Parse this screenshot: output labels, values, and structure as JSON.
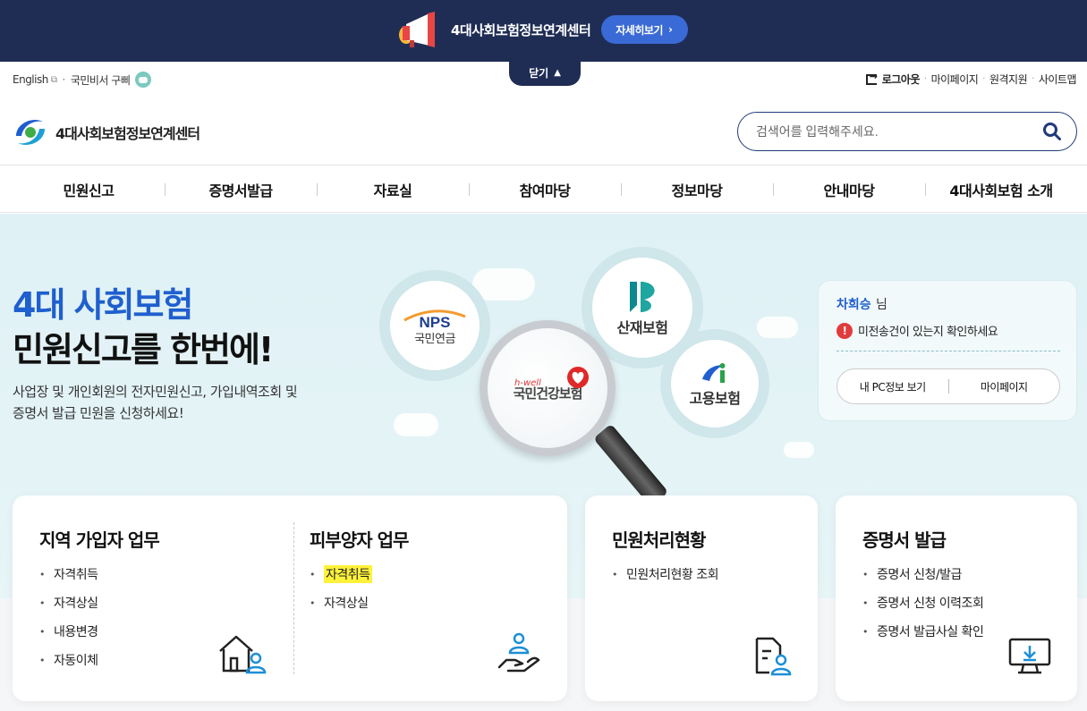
{
  "banner": {
    "title": "4대사회보험정보연계센터",
    "more_label": "자세히보기",
    "close_label": "닫기"
  },
  "util": {
    "english": "English",
    "chatbot": "국민비서 구삐",
    "logout": "로그아웃",
    "mypage": "마이페이지",
    "remote": "원격지원",
    "sitemap": "사이트맵"
  },
  "logo": {
    "text": "4대사회보험정보연계센터"
  },
  "search": {
    "placeholder": "검색어를 입력해주세요."
  },
  "nav": {
    "items": [
      {
        "label": "민원신고"
      },
      {
        "label": "증명서발급"
      },
      {
        "label": "자료실"
      },
      {
        "label": "참여마당"
      },
      {
        "label": "정보마당"
      },
      {
        "label": "안내마당"
      },
      {
        "label": "4대사회보험 소개"
      }
    ]
  },
  "hero": {
    "title_line1": "4대 사회보험",
    "title_line2": "민원신고를 한번에!",
    "desc_line1": "사업장 및 개인회원의 전자민원신고, 가입내역조회 및",
    "desc_line2": "증명서 발급 민원을 신청하세요!"
  },
  "insurers": {
    "nps_logo": "NPS",
    "nps": "국민연금",
    "kcomwel": "산재보험",
    "ei": "고용보험",
    "nhis_logo": "h-well",
    "nhis": "국민건강보험"
  },
  "user_panel": {
    "name": "차희승",
    "suffix": "님",
    "alert": "미전송건이 있는지 확인하세요",
    "pc_info": "내 PC정보 보기",
    "mypage": "마이페이지"
  },
  "cards": {
    "regional": {
      "title": "지역 가입자 업무",
      "items": [
        "자격취득",
        "자격상실",
        "내용변경",
        "자동이체"
      ]
    },
    "dependent": {
      "title": "피부양자 업무",
      "items": [
        "자격취득",
        "자격상실"
      ]
    },
    "status": {
      "title": "민원처리현황",
      "items": [
        "민원처리현황 조회"
      ]
    },
    "cert": {
      "title": "증명서 발급",
      "items": [
        "증명서 신청/발급",
        "증명서 신청 이력조회",
        "증명서 발급사실 확인"
      ]
    }
  },
  "colors": {
    "banner_bg": "#1f2d55",
    "accent_blue": "#1f5fcf",
    "hero_bg": "#dff1f5",
    "highlight": "#fff23a",
    "alert_red": "#e23b3b"
  }
}
